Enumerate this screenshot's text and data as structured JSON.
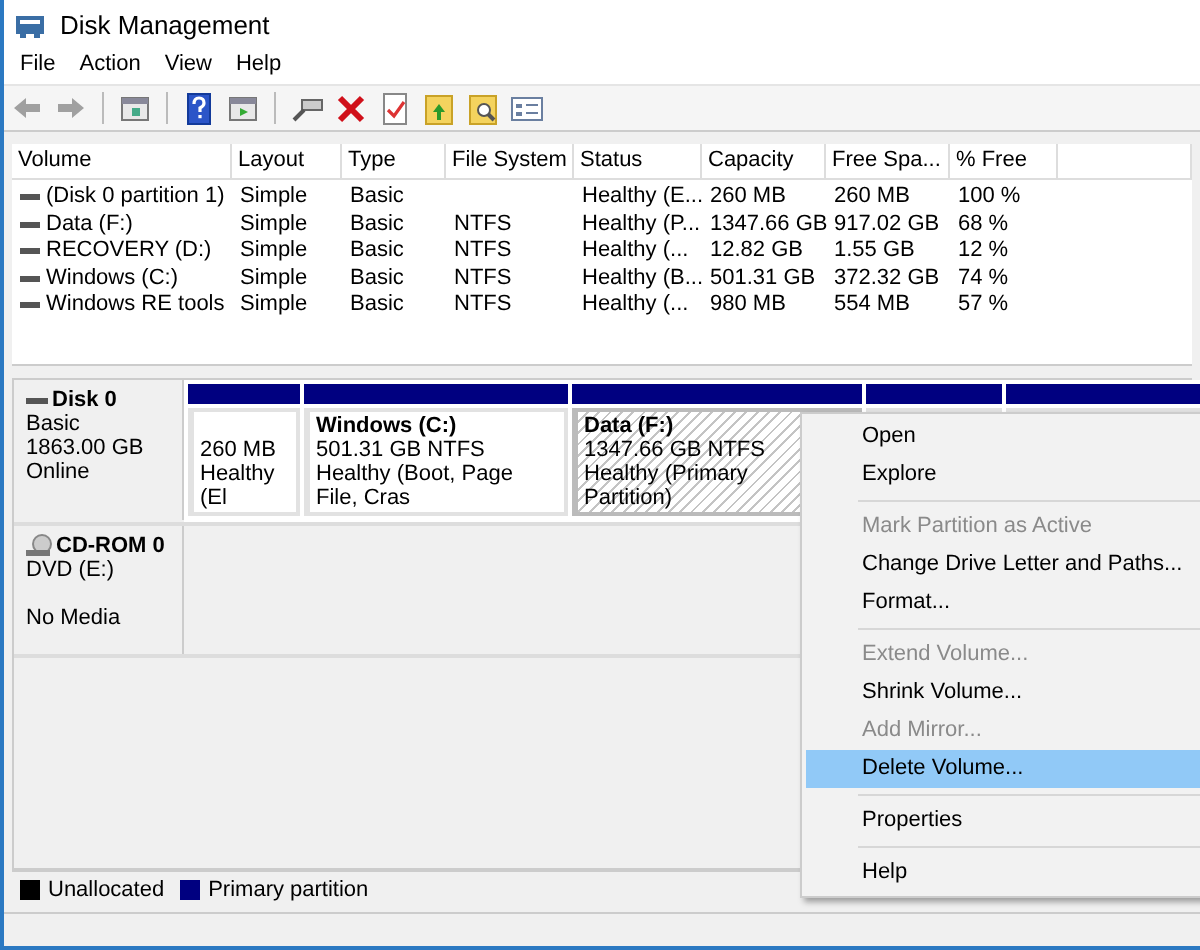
{
  "window": {
    "title": "Disk Management"
  },
  "menu_bar": [
    {
      "label": "File"
    },
    {
      "label": "Action"
    },
    {
      "label": "View"
    },
    {
      "label": "Help"
    }
  ],
  "toolbar": [
    {
      "kind": "back",
      "disabled": true
    },
    {
      "kind": "forward",
      "disabled": true
    },
    {
      "kind": "separator"
    },
    {
      "kind": "console",
      "disabled": false
    },
    {
      "kind": "separator"
    },
    {
      "kind": "help",
      "disabled": false
    },
    {
      "kind": "panel",
      "disabled": false
    },
    {
      "kind": "separator"
    },
    {
      "kind": "connect",
      "disabled": false
    },
    {
      "kind": "delete",
      "disabled": false
    },
    {
      "kind": "checklist",
      "disabled": false
    },
    {
      "kind": "folder-up",
      "disabled": false
    },
    {
      "kind": "folder-search",
      "disabled": false
    },
    {
      "kind": "properties",
      "disabled": false
    }
  ],
  "volumes": {
    "columns": [
      "Volume",
      "Layout",
      "Type",
      "File System",
      "Status",
      "Capacity",
      "Free Spa...",
      "% Free"
    ],
    "rows": [
      {
        "volume": "(Disk 0 partition 1)",
        "layout": "Simple",
        "type": "Basic",
        "status": "Healthy (E...",
        "capacity": "260 MB",
        "free_space": "260 MB",
        "percent_free": "100 %"
      },
      {
        "volume": "Data (F:)",
        "layout": "Simple",
        "type": "Basic",
        "file_system": "NTFS",
        "status": "Healthy (P...",
        "capacity": "1347.66 GB",
        "free_space": "917.02 GB",
        "percent_free": "68 %"
      },
      {
        "volume": "RECOVERY (D:)",
        "layout": "Simple",
        "type": "Basic",
        "file_system": "NTFS",
        "status": "Healthy (...",
        "capacity": "12.82 GB",
        "free_space": "1.55 GB",
        "percent_free": "12 %"
      },
      {
        "volume": "Windows (C:)",
        "layout": "Simple",
        "type": "Basic",
        "file_system": "NTFS",
        "status": "Healthy (B...",
        "capacity": "501.31 GB",
        "free_space": "372.32 GB",
        "percent_free": "74 %"
      },
      {
        "volume": "Windows RE tools",
        "layout": "Simple",
        "type": "Basic",
        "file_system": "NTFS",
        "status": "Healthy (...",
        "capacity": "980 MB",
        "free_space": "554 MB",
        "percent_free": "57 %"
      }
    ]
  },
  "disks": [
    {
      "kind": "disk",
      "name": "Disk 0",
      "details": [
        "Basic",
        "1863.00 GB",
        "Online"
      ],
      "partitions": [
        {
          "lines": [
            "260 MB",
            "Healthy (El"
          ],
          "selected": false
        },
        {
          "title": "Windows  (C:)",
          "lines": [
            "501.31 GB NTFS",
            "Healthy (Boot, Page File, Cras"
          ],
          "selected": false
        },
        {
          "title": "Data  (F:)",
          "lines": [
            "1347.66 GB NTFS",
            "Healthy (Primary Partition)"
          ],
          "selected": true
        },
        {
          "selected": false
        },
        {
          "selected": false
        }
      ]
    },
    {
      "kind": "cdrom",
      "name": "CD-ROM 0",
      "details": [
        "DVD (E:)"
      ],
      "media": "No Media"
    }
  ],
  "context_menu": [
    {
      "kind": "item",
      "label": "Open",
      "disabled": false,
      "selected": false
    },
    {
      "kind": "item",
      "label": "Explore",
      "disabled": false,
      "selected": false
    },
    {
      "kind": "separator"
    },
    {
      "kind": "item",
      "label": "Mark Partition as Active",
      "disabled": true,
      "selected": false
    },
    {
      "kind": "item",
      "label": "Change Drive Letter and Paths...",
      "disabled": false,
      "selected": false
    },
    {
      "kind": "item",
      "label": "Format...",
      "disabled": false,
      "selected": false
    },
    {
      "kind": "separator"
    },
    {
      "kind": "item",
      "label": "Extend Volume...",
      "disabled": true,
      "selected": false
    },
    {
      "kind": "item",
      "label": "Shrink Volume...",
      "disabled": false,
      "selected": false
    },
    {
      "kind": "item",
      "label": "Add Mirror...",
      "disabled": true,
      "selected": false
    },
    {
      "kind": "item",
      "label": "Delete Volume...",
      "disabled": false,
      "selected": true
    },
    {
      "kind": "separator"
    },
    {
      "kind": "item",
      "label": "Properties",
      "disabled": false,
      "selected": false
    },
    {
      "kind": "separator"
    },
    {
      "kind": "item",
      "label": "Help",
      "disabled": false,
      "selected": false
    }
  ],
  "legend": [
    {
      "label": "Unallocated",
      "color": "#000000"
    },
    {
      "label": "Primary partition",
      "color": "#000080"
    }
  ]
}
